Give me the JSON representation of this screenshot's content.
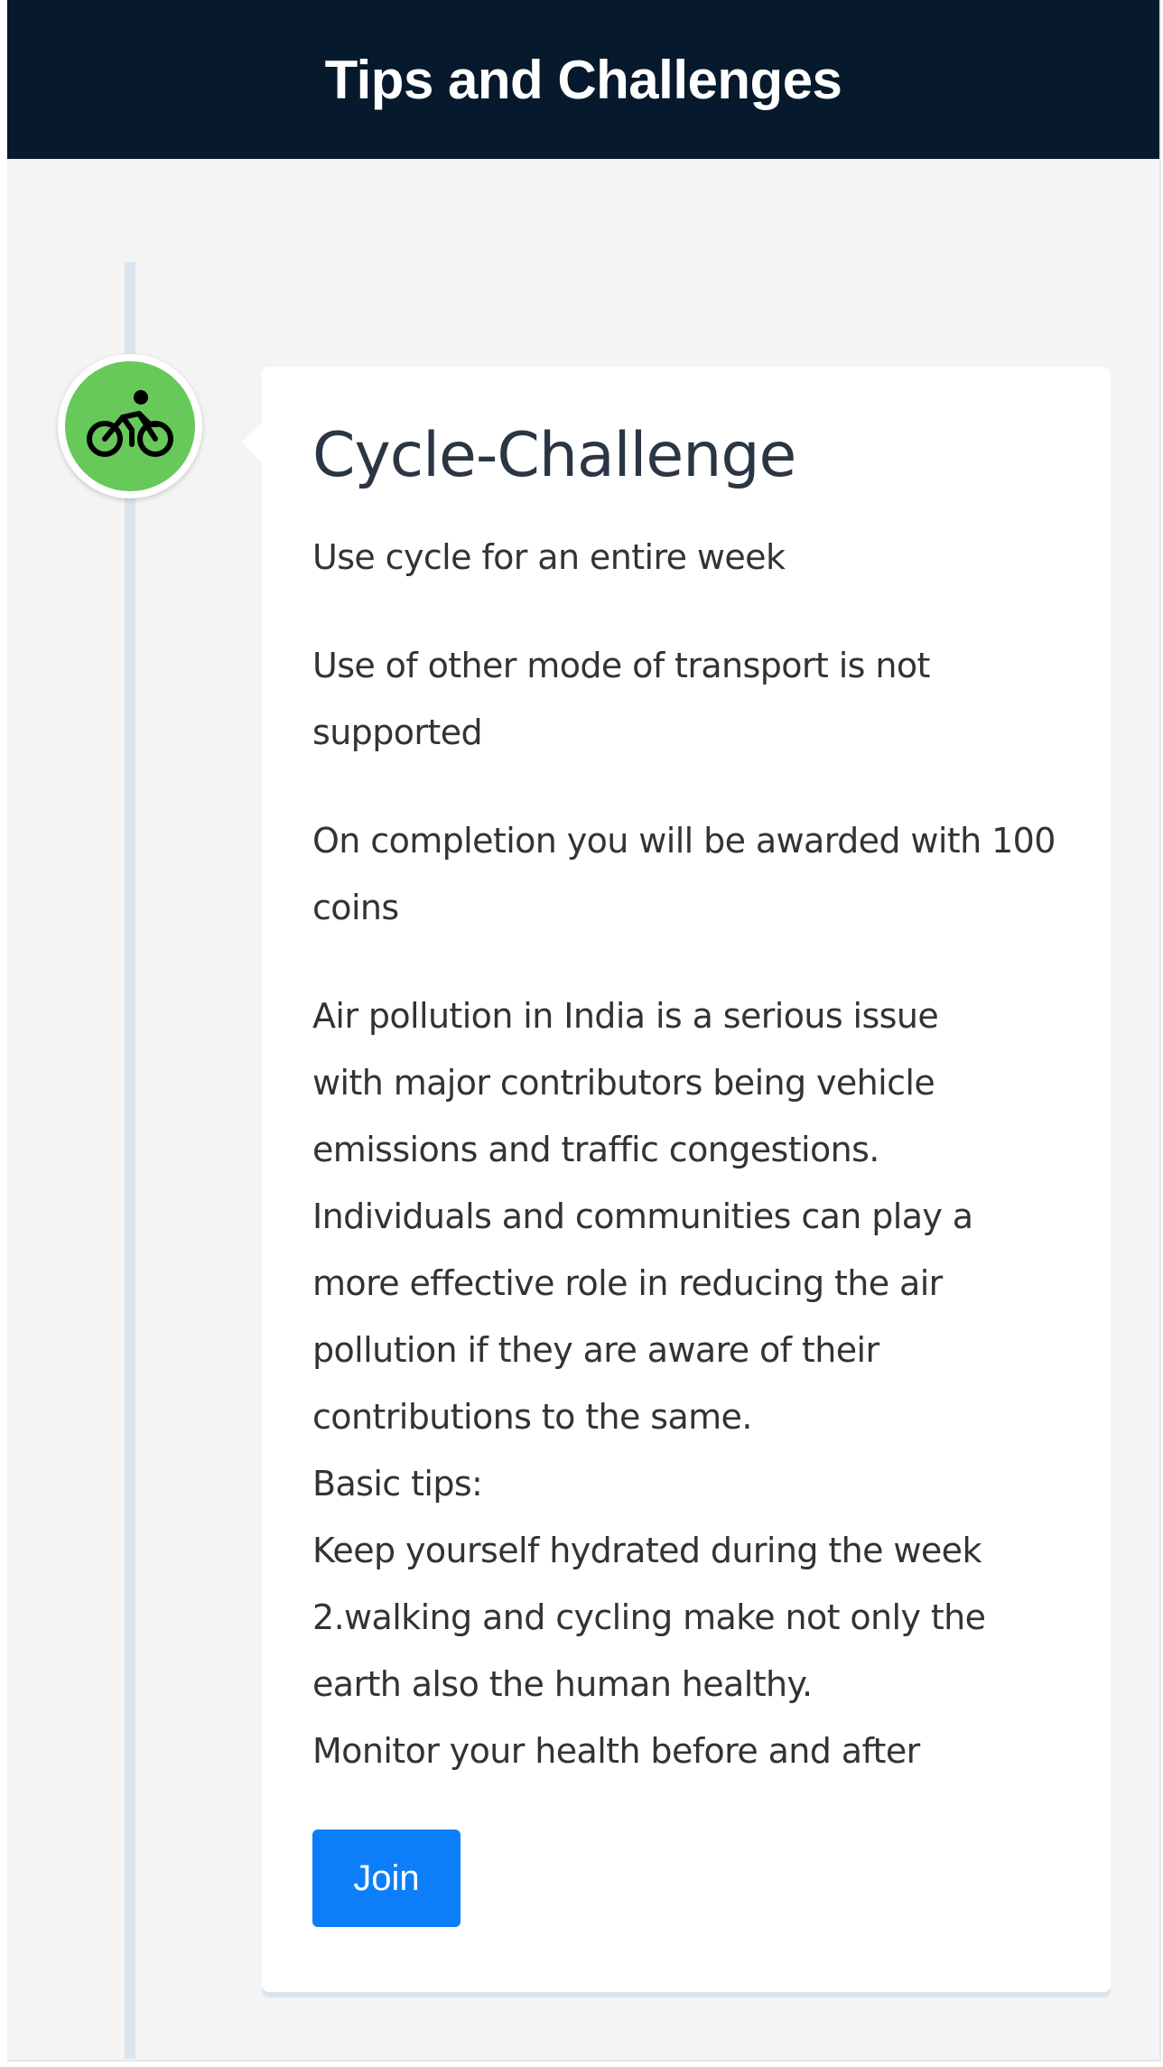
{
  "header": {
    "title": "Tips and Challenges"
  },
  "timeline": {
    "marker_icon": "bicycle-rider-icon",
    "marker_color": "#66c95a"
  },
  "challenge": {
    "title": "Cycle-Challenge",
    "summary": "Use cycle for an entire week",
    "rule": "Use of other mode of transport is not supported",
    "reward": "On completion you will be awarded with 100 coins",
    "description_lines": [
      "Air pollution in India is a serious issue",
      "with major contributors being vehicle",
      "emissions and traffic congestions.",
      "Individuals and communities can play a",
      "more effective role in reducing the air",
      "pollution if they are aware of their",
      "contributions to the same.",
      "Basic tips:",
      "Keep yourself hydrated during the week",
      "2.walking and cycling make not only the",
      "earth also the human healthy.",
      "Monitor your health before and after"
    ],
    "join_label": "Join",
    "join_color": "#0d7ef9"
  },
  "colors": {
    "header_bg": "#06192d",
    "page_bg": "#f4f4f5",
    "timeline_line": "#dbe5ee"
  }
}
